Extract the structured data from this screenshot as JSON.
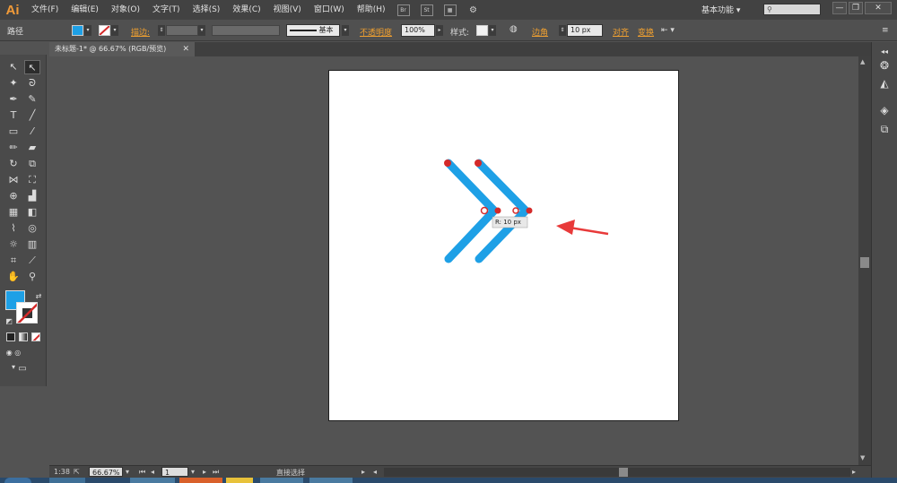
{
  "app": {
    "logo": "Ai"
  },
  "menu": [
    "文件(F)",
    "编辑(E)",
    "对象(O)",
    "文字(T)",
    "选择(S)",
    "效果(C)",
    "视图(V)",
    "窗口(W)",
    "帮助(H)"
  ],
  "menu_tools": {
    "bridge": "Br",
    "stock": "St"
  },
  "workspace": {
    "label": "基本功能",
    "search_placeholder": ""
  },
  "window_controls": {
    "minimize": "—",
    "restore": "❐",
    "close": "✕"
  },
  "control_bar": {
    "selection_type": "路径",
    "stroke_label": "描边:",
    "stroke_style": "基本",
    "opacity_label": "不透明度",
    "opacity_value": "100%",
    "style_label": "样式:",
    "corner_label": "边角",
    "corner_value": "10 px",
    "align_label": "对齐",
    "transform_label": "变换",
    "colors": {
      "fill": "#1ea0e6",
      "stroke": "none",
      "accent": "#f0a030"
    }
  },
  "document_tab": {
    "title": "未标题-1* @ 66.67% (RGB/预览)",
    "close": "✕"
  },
  "canvas": {
    "tooltip_text": "R: 10 px",
    "shape_color": "#1ea0e6",
    "anchor_color": "#d42a2a",
    "arrow_color": "#e83a3a"
  },
  "status_bar": {
    "angle": "1:38",
    "zoom": "66.67%",
    "page": "1",
    "tool_name": "直接选择"
  }
}
